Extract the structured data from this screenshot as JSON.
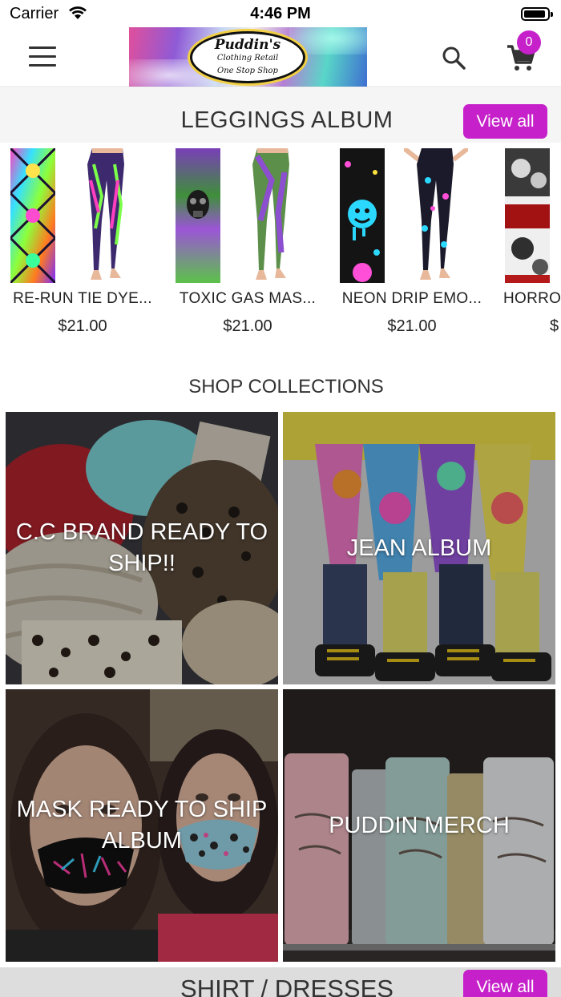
{
  "status_bar": {
    "carrier": "Carrier",
    "time": "4:46 PM"
  },
  "header": {
    "logo_text": "Puddin's",
    "logo_line2": "Clothing Retail",
    "logo_line3": "One Stop Shop",
    "cart_count": "0",
    "icons": [
      "menu-icon",
      "search-icon",
      "cart-icon"
    ]
  },
  "leggings": {
    "title": "LEGGINGS ALBUM",
    "view_all": "View all",
    "products": [
      {
        "name": "RE-RUN TIE DYE...",
        "price": "$21.00"
      },
      {
        "name": "TOXIC GAS MAS...",
        "price": "$21.00"
      },
      {
        "name": "NEON DRIP EMO...",
        "price": "$21.00"
      },
      {
        "name": "HORRO",
        "price": "$"
      }
    ]
  },
  "collections": {
    "title": "SHOP COLLECTIONS",
    "items": [
      {
        "label": "C.C BRAND READY TO SHIP!!"
      },
      {
        "label": "JEAN ALBUM"
      },
      {
        "label": "MASK READY TO SHIP ALBUM"
      },
      {
        "label": "PUDDIN MERCH"
      }
    ]
  },
  "shirts": {
    "title": "SHIRT / DRESSES",
    "view_all": "View all"
  },
  "colors": {
    "accent": "#c520c9"
  }
}
